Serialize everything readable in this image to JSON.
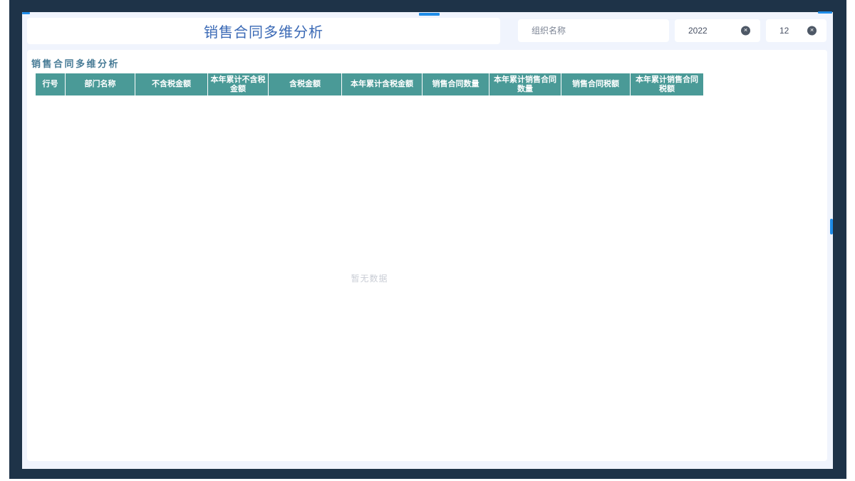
{
  "header": {
    "title": "销售合同多维分析"
  },
  "filters": {
    "org_name": {
      "placeholder": "组织名称",
      "value": ""
    },
    "year": {
      "value": "2022"
    },
    "month": {
      "value": "12"
    },
    "clear_icon": "✕"
  },
  "content": {
    "section_title": "销售合同多维分析",
    "table": {
      "columns": [
        "行号",
        "部门名称",
        "不含税金额",
        "本年累计不含税金额",
        "含税金额",
        "本年累计含税金额",
        "销售合同数量",
        "本年累计销售合同数量",
        "销售合同税额",
        "本年累计销售合同税额"
      ],
      "rows": [],
      "empty_text": "暂无数据"
    }
  },
  "colors": {
    "frame_navy": "#1e3348",
    "canvas_lavender": "#f0f4fd",
    "table_header_teal": "#4a9a97",
    "title_blue": "#3a69b5",
    "section_title_blue": "#477b96",
    "accent_blue": "#1e8ce8",
    "empty_text_gray": "#c9cdd5"
  }
}
